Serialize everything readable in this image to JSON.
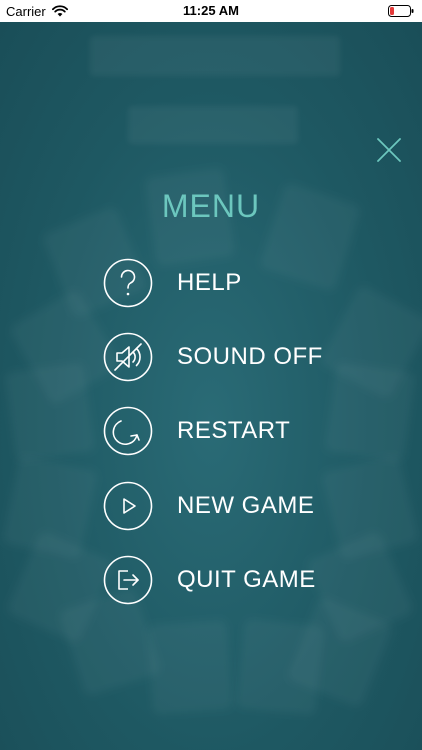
{
  "status_bar": {
    "carrier": "Carrier",
    "time": "11:25 AM",
    "battery_color": "#e53b3b"
  },
  "menu": {
    "title": "MENU",
    "title_color": "#6cc7be",
    "close_icon": "close-icon",
    "items": [
      {
        "label": "HELP",
        "icon": "question-icon"
      },
      {
        "label": "SOUND OFF",
        "icon": "speaker-muted-icon"
      },
      {
        "label": "RESTART",
        "icon": "restart-icon"
      },
      {
        "label": "NEW GAME",
        "icon": "play-icon"
      },
      {
        "label": "QUIT GAME",
        "icon": "quit-icon"
      }
    ]
  },
  "colors": {
    "background": "#1f5b66",
    "text": "#ffffff"
  }
}
